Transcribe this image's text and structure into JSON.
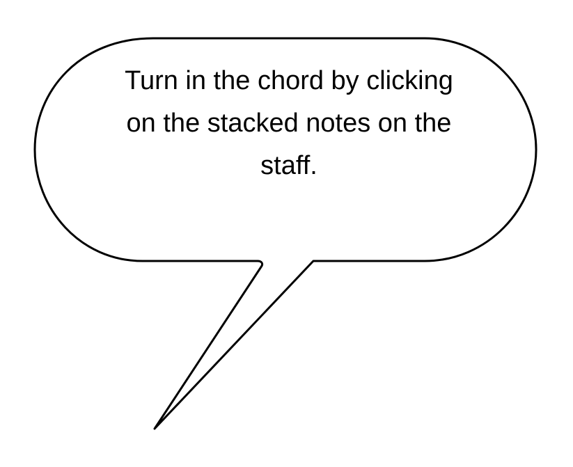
{
  "speech_bubble": {
    "line_1": "Turn in the chord by clicking",
    "line_2": "on the stacked notes on the",
    "line_3": "staff."
  },
  "colors": {
    "background": "#ffffff",
    "outline": "#000000",
    "text": "#000000"
  }
}
